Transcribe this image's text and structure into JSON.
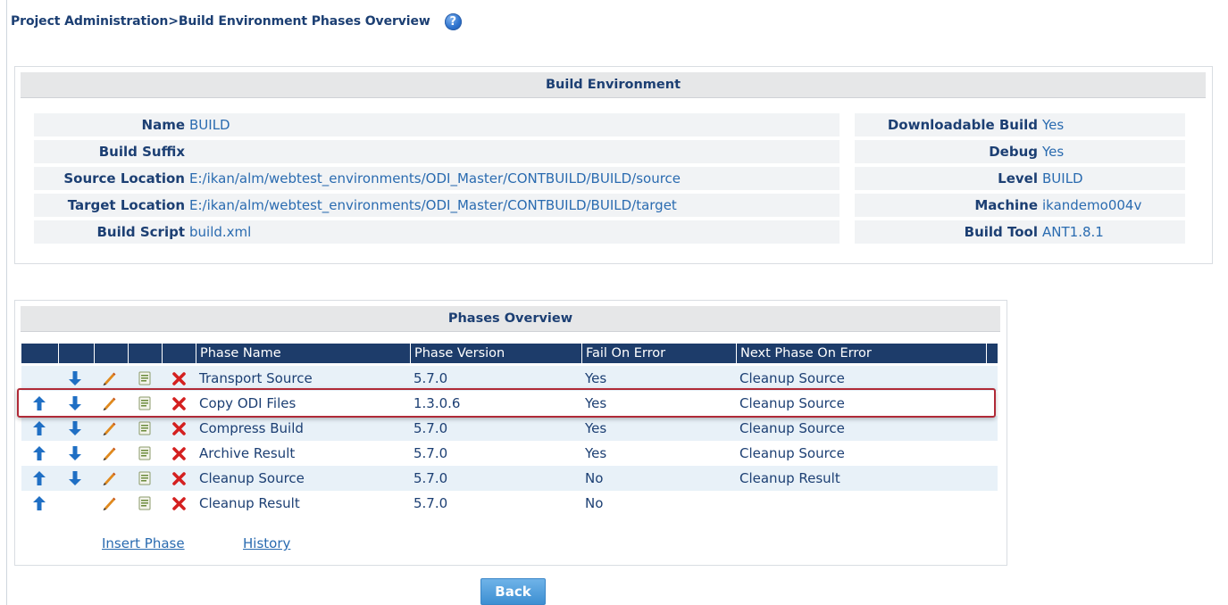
{
  "header": {
    "breadcrumb": "Project Administration>Build Environment Phases Overview",
    "help_glyph": "?"
  },
  "build_environment": {
    "title": "Build Environment",
    "left_fields": [
      {
        "label": "Name",
        "value": "BUILD"
      },
      {
        "label": "Build Suffix",
        "value": ""
      },
      {
        "label": "Source Location",
        "value": "E:/ikan/alm/webtest_environments/ODI_Master/CONTBUILD/BUILD/source"
      },
      {
        "label": "Target Location",
        "value": "E:/ikan/alm/webtest_environments/ODI_Master/CONTBUILD/BUILD/target"
      },
      {
        "label": "Build Script",
        "value": "build.xml"
      }
    ],
    "right_fields": [
      {
        "label": "Downloadable Build",
        "value": "Yes"
      },
      {
        "label": "Debug",
        "value": "Yes"
      },
      {
        "label": "Level",
        "value": "BUILD"
      },
      {
        "label": "Machine",
        "value": "ikandemo004v"
      },
      {
        "label": "Build Tool",
        "value": "ANT1.8.1"
      }
    ]
  },
  "phases": {
    "title": "Phases Overview",
    "columns": [
      "Phase Name",
      "Phase Version",
      "Fail On Error",
      "Next Phase On Error"
    ],
    "rows": [
      {
        "name": "Transport Source",
        "version": "5.7.0",
        "fail_on_error": "Yes",
        "next_phase": "Cleanup Source",
        "can_move_up": false,
        "can_move_down": true
      },
      {
        "name": "Copy ODI Files",
        "version": "1.3.0.6",
        "fail_on_error": "Yes",
        "next_phase": "Cleanup Source",
        "can_move_up": true,
        "can_move_down": true
      },
      {
        "name": "Compress Build",
        "version": "5.7.0",
        "fail_on_error": "Yes",
        "next_phase": "Cleanup Source",
        "can_move_up": true,
        "can_move_down": true
      },
      {
        "name": "Archive Result",
        "version": "5.7.0",
        "fail_on_error": "Yes",
        "next_phase": "Cleanup Source",
        "can_move_up": true,
        "can_move_down": true
      },
      {
        "name": "Cleanup Source",
        "version": "5.7.0",
        "fail_on_error": "No",
        "next_phase": "Cleanup Result",
        "can_move_up": true,
        "can_move_down": true
      },
      {
        "name": "Cleanup Result",
        "version": "5.7.0",
        "fail_on_error": "No",
        "next_phase": "",
        "can_move_up": true,
        "can_move_down": false
      }
    ],
    "selected_row": 1,
    "icons": [
      "move-up-icon",
      "move-down-icon",
      "edit-icon",
      "view-icon",
      "delete-icon"
    ]
  },
  "links": {
    "insert_phase": "Insert Phase",
    "history": "History"
  },
  "back_label": "Back",
  "colors": {
    "table_header": "#1d3c6a",
    "alt_row": "#e8f1f8",
    "label": "#1c3f73",
    "value": "#2a6bb0",
    "selection_outline": "#b02a37"
  }
}
